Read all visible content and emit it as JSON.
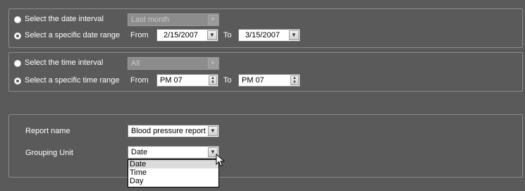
{
  "date_section": {
    "interval_label": "Select the date interval",
    "interval_value": "Last month",
    "range_label": "Select a specific date range",
    "from_label": "From",
    "from_value": "2/15/2007",
    "to_label": "To",
    "to_value": "3/15/2007",
    "selected_option": "range"
  },
  "time_section": {
    "interval_label": "Select the time interval",
    "interval_value": "All",
    "range_label": "Select a specific time range",
    "from_label": "From",
    "from_value": "PM 07",
    "to_label": "To",
    "to_value": "PM 07",
    "selected_option": "range"
  },
  "report": {
    "name_label": "Report name",
    "name_value": "Blood pressure report",
    "grouping_label": "Grouping Unit",
    "grouping_value": "Date",
    "grouping_options": [
      "Date",
      "Time",
      "Day"
    ]
  },
  "icons": {
    "dropdown_arrow": "chevron-down-icon",
    "spinner": "spinner-arrows-icon",
    "cursor": "mouse-pointer-icon"
  },
  "colors": {
    "background": "#5a5a5a",
    "panel_border": "#8a8a8a",
    "text": "#ffffff",
    "disabled_field": "#8c8c8c"
  }
}
